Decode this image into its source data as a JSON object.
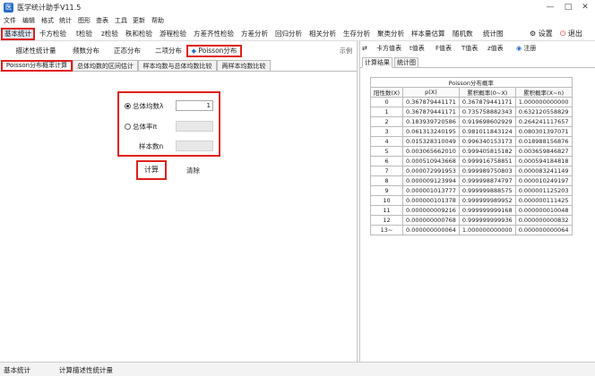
{
  "window": {
    "title": "医学统计助手V11.5",
    "minimize": "—",
    "maximize": "□",
    "close": "✕"
  },
  "menu": [
    "文件",
    "编辑",
    "格式",
    "统计",
    "图形",
    "查表",
    "工具",
    "更新",
    "帮助"
  ],
  "toolbar": {
    "items": [
      "基本统计",
      "卡方检验",
      "t检验",
      "z检验",
      "秩和检验",
      "游程检验",
      "方差齐性检验",
      "方差分析",
      "回归分析",
      "相关分析",
      "生存分析",
      "聚类分析",
      "样本量估算",
      "随机数",
      "统计图"
    ],
    "settings": "设置",
    "exit": "退出"
  },
  "subtabs": [
    "描述性统计量",
    "频数分布",
    "正态分布",
    "二项分布",
    "Poisson分布"
  ],
  "example_label": "示例",
  "tabs2": [
    "Poisson分布概率计算",
    "总体均数的区间估计",
    "样本均数与总体均数比较",
    "两样本均数比较"
  ],
  "form": {
    "mean_label": "总体均数λ",
    "mean_value": "1",
    "rate_label": "总体率π",
    "rate_value": "",
    "n_label": "样本数n",
    "n_value": ""
  },
  "buttons": {
    "calc": "计算",
    "clear": "清除"
  },
  "dist_tables": [
    "卡方值表",
    "t值表",
    "F值表",
    "T值表",
    "z值表"
  ],
  "register": "注册",
  "result_tabs": [
    "计算结果",
    "统计图"
  ],
  "table": {
    "caption": "Poisson分布概率",
    "headers": [
      "阳性数(X)",
      "p(X)",
      "累积概率(0~X)",
      "累积概率(X~n)"
    ],
    "rows": [
      [
        "0",
        "0.367879441171",
        "0.367879441171",
        "1.000000000000"
      ],
      [
        "1",
        "0.367879441171",
        "0.735758882343",
        "0.632120558829"
      ],
      [
        "2",
        "0.183939720586",
        "0.919698602929",
        "0.264241117657"
      ],
      [
        "3",
        "0.061313240195",
        "0.981011843124",
        "0.080301397071"
      ],
      [
        "4",
        "0.015328310049",
        "0.996340153173",
        "0.018988156876"
      ],
      [
        "5",
        "0.003065662010",
        "0.999405815182",
        "0.003659846827"
      ],
      [
        "6",
        "0.000510943668",
        "0.999916758851",
        "0.000594184818"
      ],
      [
        "7",
        "0.000072991953",
        "0.999989750803",
        "0.000083241149"
      ],
      [
        "8",
        "0.000009123994",
        "0.999998874797",
        "0.000010249197"
      ],
      [
        "9",
        "0.000001013777",
        "0.999999888575",
        "0.000001125203"
      ],
      [
        "10",
        "0.000000101378",
        "0.999999989952",
        "0.000000111425"
      ],
      [
        "11",
        "0.000000009216",
        "0.999999999168",
        "0.000000010048"
      ],
      [
        "12",
        "0.000000000768",
        "0.999999999936",
        "0.000000000832"
      ],
      [
        "13~",
        "0.000000000064",
        "1.000000000000",
        "0.000000000064"
      ]
    ]
  },
  "status": {
    "left": "基本统计",
    "right": "计算描述性统计量"
  }
}
